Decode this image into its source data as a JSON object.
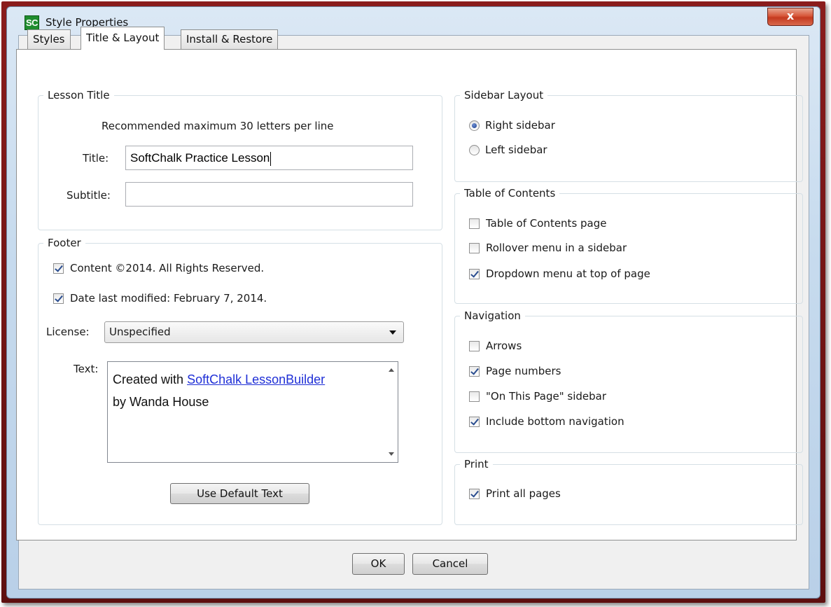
{
  "window": {
    "icon_text": "SC",
    "title": "Style Properties",
    "close_glyph": "x"
  },
  "tabs": [
    {
      "label": "Styles",
      "active": false
    },
    {
      "label": "Title & Layout",
      "active": true
    },
    {
      "label": "Install & Restore",
      "active": false
    }
  ],
  "lesson_title": {
    "legend": "Lesson Title",
    "hint": "Recommended maximum 30 letters per line",
    "title_label": "Title:",
    "title_value": "SoftChalk Practice Lesson",
    "subtitle_label": "Subtitle:",
    "subtitle_value": ""
  },
  "footer": {
    "legend": "Footer",
    "content_checkbox": {
      "label": "Content ©2014. All Rights Reserved.",
      "checked": true
    },
    "date_checkbox": {
      "label": "Date last modified: February 7, 2014.",
      "checked": true
    },
    "license_label": "License:",
    "license_value": "Unspecified",
    "text_label": "Text:",
    "text_line1_prefix": "Created with ",
    "text_link": "SoftChalk LessonBuilder",
    "text_line2": "by Wanda House",
    "default_button": "Use Default Text"
  },
  "sidebar_layout": {
    "legend": "Sidebar Layout",
    "options": [
      {
        "label": "Right sidebar",
        "selected": true
      },
      {
        "label": "Left sidebar",
        "selected": false
      }
    ]
  },
  "toc": {
    "legend": "Table of Contents",
    "items": [
      {
        "label": "Table of Contents page",
        "checked": false
      },
      {
        "label": "Rollover menu in a sidebar",
        "checked": false
      },
      {
        "label": "Dropdown menu at top of page",
        "checked": true
      }
    ]
  },
  "navigation": {
    "legend": "Navigation",
    "items": [
      {
        "label": "Arrows",
        "checked": false
      },
      {
        "label": "Page numbers",
        "checked": true
      },
      {
        "label": "\"On This Page\" sidebar",
        "checked": false
      },
      {
        "label": "Include bottom navigation",
        "checked": true
      }
    ]
  },
  "print": {
    "legend": "Print",
    "items": [
      {
        "label": "Print all pages",
        "checked": true
      }
    ]
  },
  "buttons": {
    "ok": "OK",
    "cancel": "Cancel"
  },
  "colors": {
    "frame": "#8a1c1c",
    "close_button": "#c43a1f",
    "link": "#1f2fd6",
    "check_mark": "#2a4d8f"
  }
}
